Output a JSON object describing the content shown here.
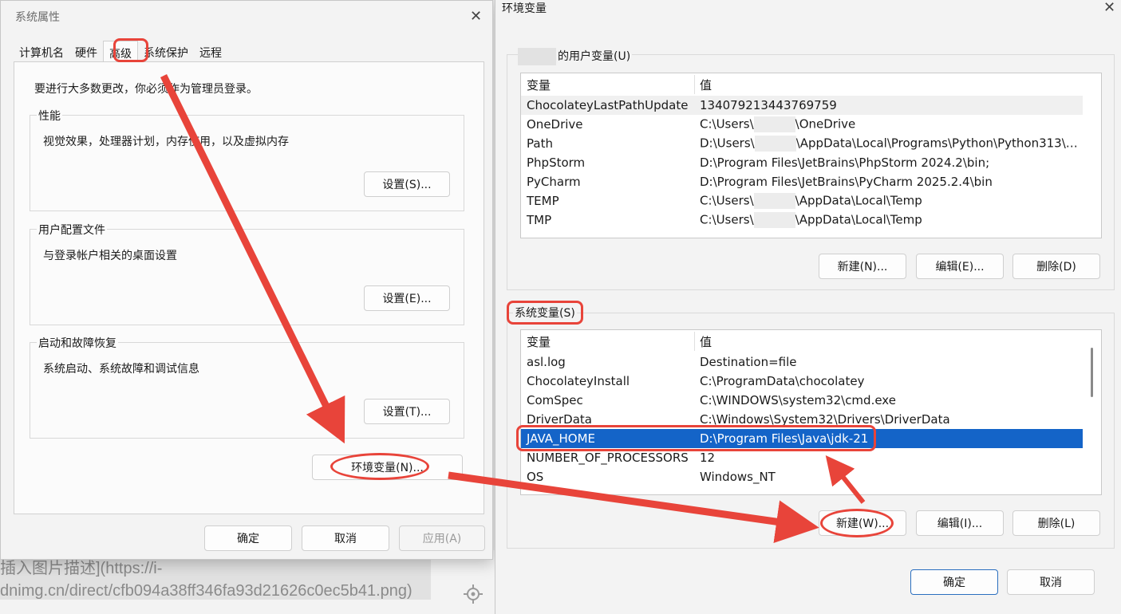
{
  "background": {
    "editor_line1": "插入图片描述](https://i-",
    "editor_line2": "dnimg.cn/direct/cfb094a38ff346fa93d21626c0ec5b41.png)"
  },
  "sys_props": {
    "title": "系统属性",
    "tabs": [
      {
        "label": "计算机名"
      },
      {
        "label": "硬件"
      },
      {
        "label": "高级"
      },
      {
        "label": "系统保护"
      },
      {
        "label": "远程"
      }
    ],
    "active_tab": "高级",
    "note": "要进行大多数更改，你必须作为管理员登录。",
    "groups": [
      {
        "label": "性能",
        "desc": "视觉效果，处理器计划，内存使用，以及虚拟内存",
        "button": "设置(S)..."
      },
      {
        "label": "用户配置文件",
        "desc": "与登录帐户相关的桌面设置",
        "button": "设置(E)..."
      },
      {
        "label": "启动和故障恢复",
        "desc": "系统启动、系统故障和调试信息",
        "button": "设置(T)..."
      }
    ],
    "env_button": "环境变量(N)...",
    "ok": "确定",
    "cancel": "取消",
    "apply": "应用(A)"
  },
  "env_vars": {
    "title": "环境变量",
    "user_section_label": "的用户变量(U)",
    "user_header": {
      "name": "变量",
      "value": "值"
    },
    "user_rows": [
      {
        "name": "ChocolateyLastPathUpdate",
        "value": "134079213443769759"
      },
      {
        "name": "OneDrive",
        "value_pre": "C:\\Users\\",
        "value_post": "\\OneDrive"
      },
      {
        "name": "Path",
        "value_pre": "D:\\Users\\",
        "value_post": "\\AppData\\Local\\Programs\\Python\\Python313\\S..."
      },
      {
        "name": "PhpStorm",
        "value": "D:\\Program Files\\JetBrains\\PhpStorm 2024.2\\bin;"
      },
      {
        "name": "PyCharm",
        "value": "D:\\Program Files\\JetBrains\\PyCharm 2025.2.4\\bin"
      },
      {
        "name": "TEMP",
        "value_pre": "C:\\Users\\",
        "value_post": "\\AppData\\Local\\Temp"
      },
      {
        "name": "TMP",
        "value_pre": "C:\\Users\\",
        "value_post": "\\AppData\\Local\\Temp"
      }
    ],
    "user_buttons": {
      "new": "新建(N)...",
      "edit": "编辑(E)...",
      "delete": "删除(D)"
    },
    "system_section_label": "系统变量(S)",
    "system_header": {
      "name": "变量",
      "value": "值"
    },
    "system_rows": [
      {
        "name": "asl.log",
        "value": "Destination=file"
      },
      {
        "name": "ChocolateyInstall",
        "value": "C:\\ProgramData\\chocolatey"
      },
      {
        "name": "ComSpec",
        "value": "C:\\WINDOWS\\system32\\cmd.exe"
      },
      {
        "name": "DriverData",
        "value": "C:\\Windows\\System32\\Drivers\\DriverData"
      },
      {
        "name": "JAVA_HOME",
        "value": "D:\\Program Files\\Java\\jdk-21",
        "selected": true
      },
      {
        "name": "NUMBER_OF_PROCESSORS",
        "value": "12"
      },
      {
        "name": "OS",
        "value": "Windows_NT"
      }
    ],
    "system_buttons": {
      "new": "新建(W)...",
      "edit": "编辑(I)...",
      "delete": "删除(L)"
    },
    "ok": "确定",
    "cancel": "取消"
  },
  "annotation_color": "#e8443a",
  "selection_color": "#1464c8"
}
